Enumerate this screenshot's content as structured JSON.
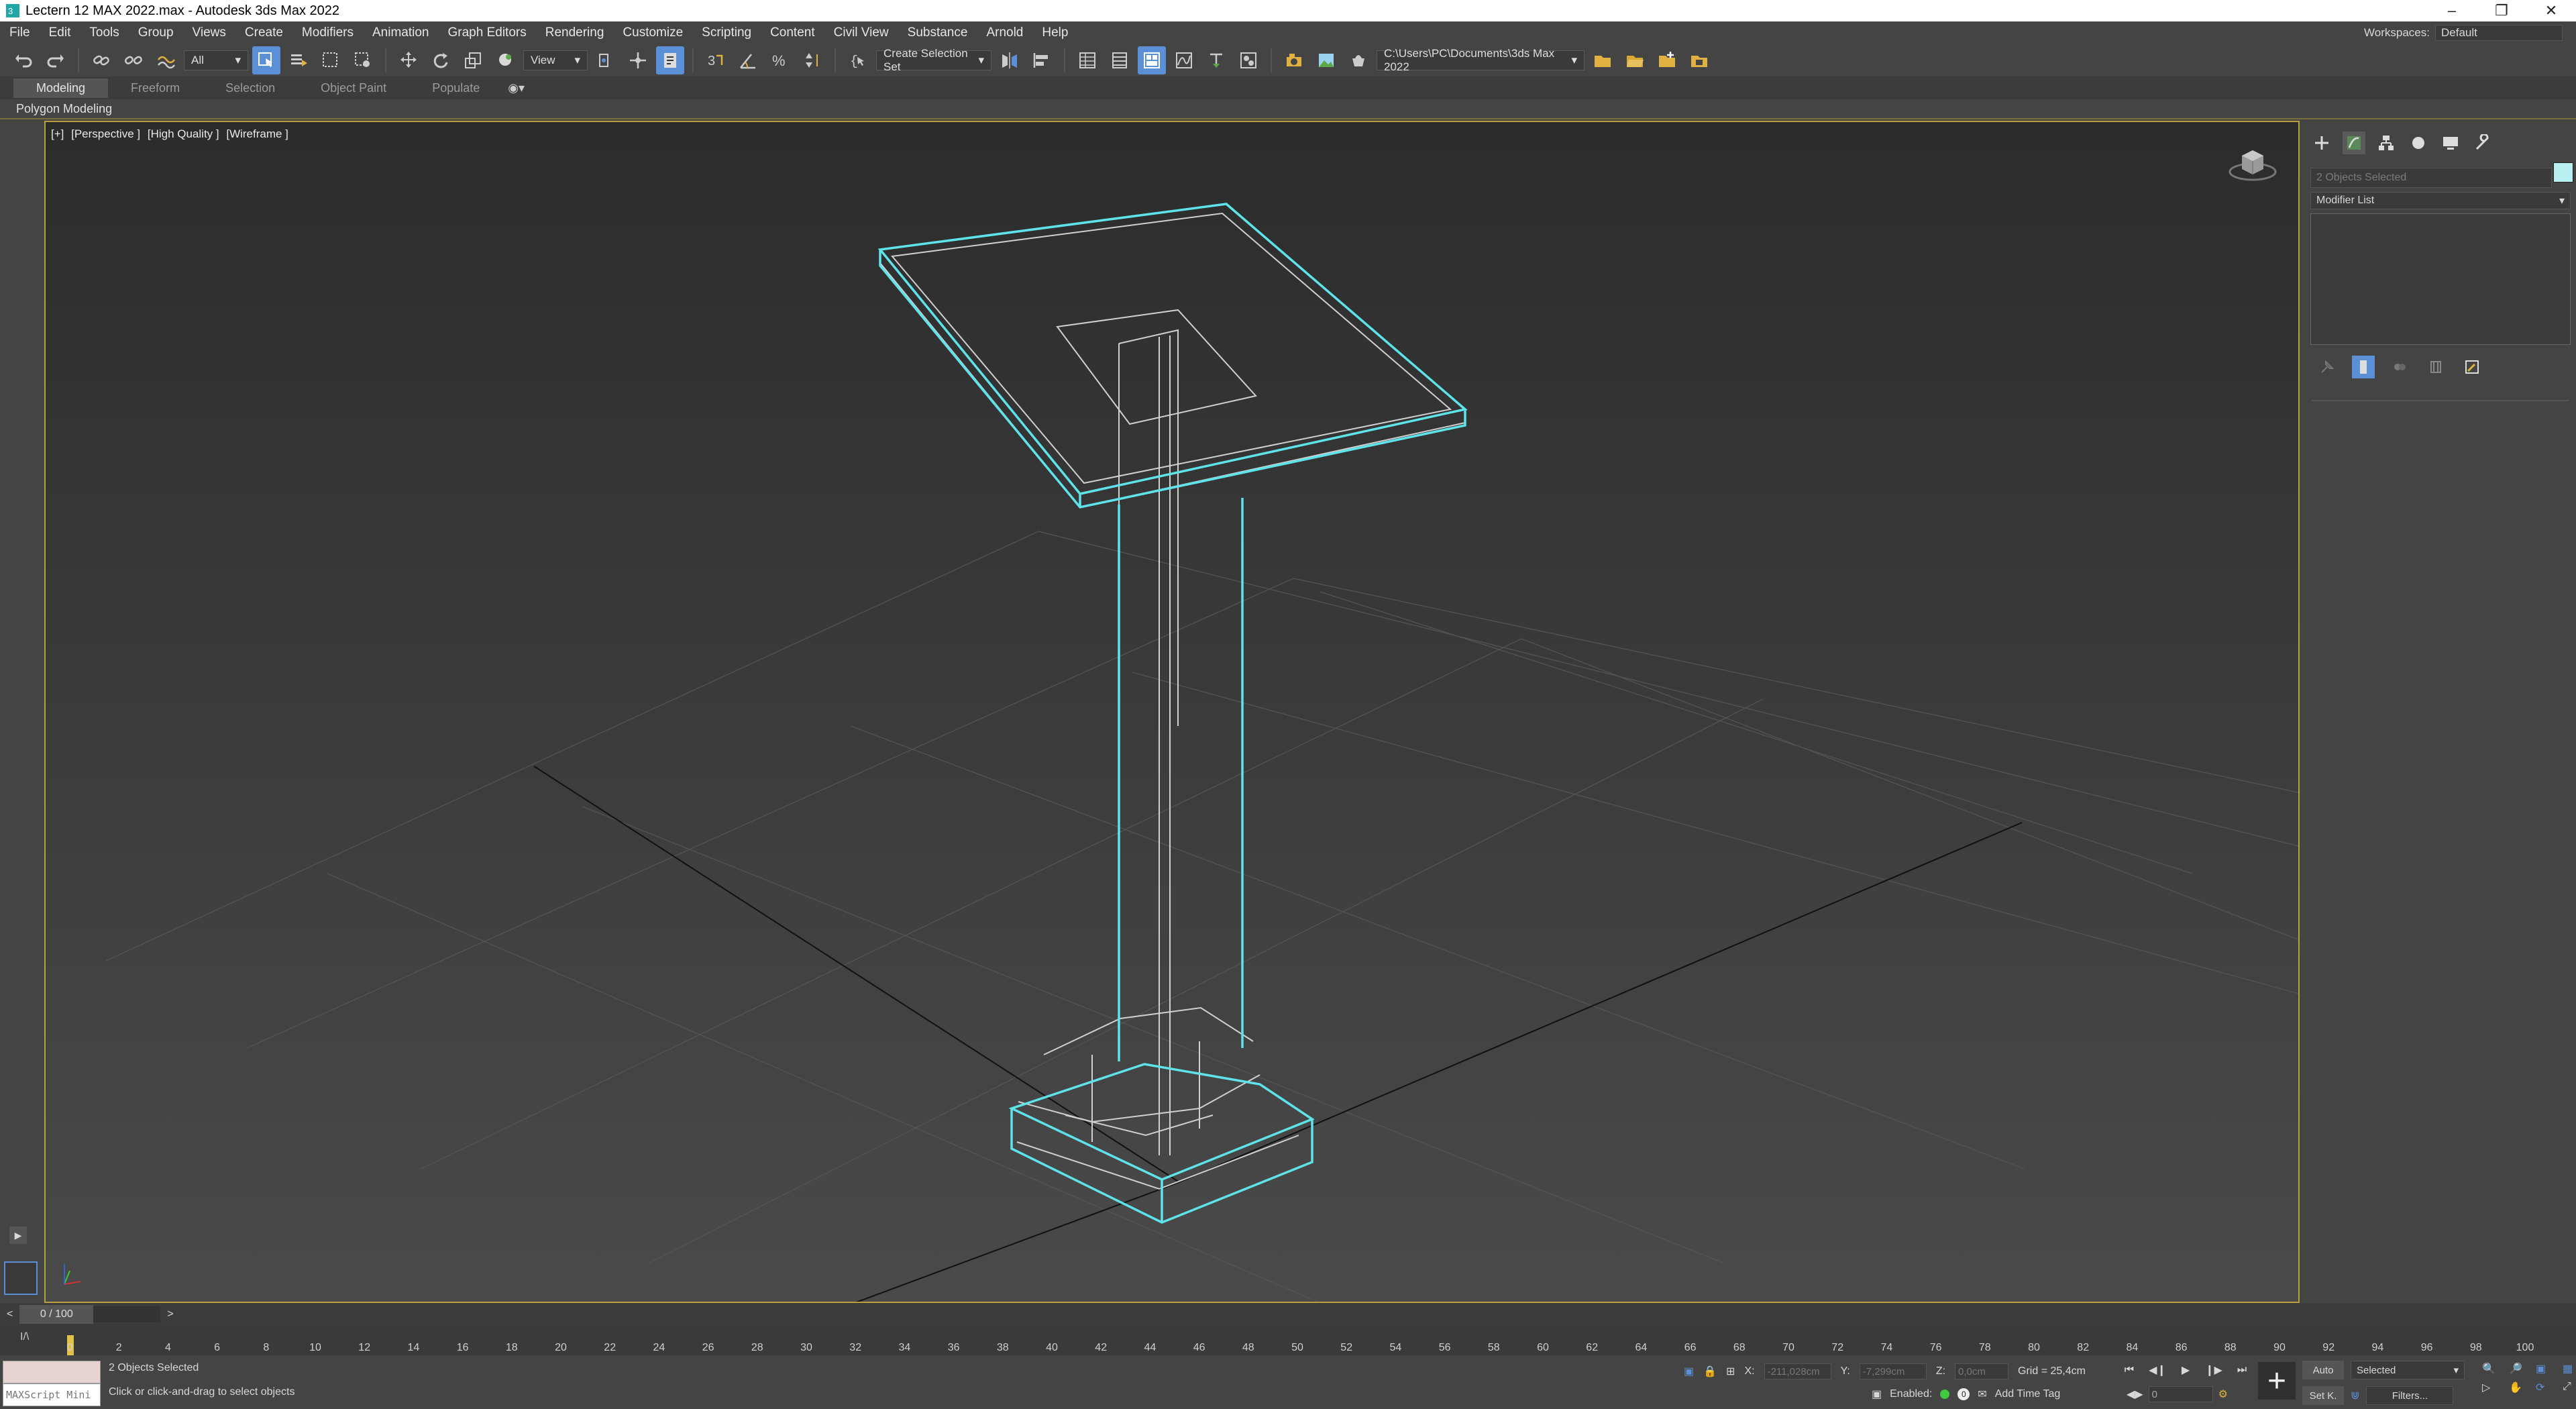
{
  "window": {
    "title": "Lectern 12 MAX 2022.max - Autodesk 3ds Max 2022",
    "app_icon": "3ds-max-icon",
    "controls": [
      "minimize-icon",
      "restore-icon",
      "close-icon"
    ]
  },
  "menu": {
    "items": [
      "File",
      "Edit",
      "Tools",
      "Group",
      "Views",
      "Create",
      "Modifiers",
      "Animation",
      "Graph Editors",
      "Rendering",
      "Customize",
      "Scripting",
      "Content",
      "Civil View",
      "Substance",
      "Arnold",
      "Help"
    ],
    "workspaces_label": "Workspaces:",
    "workspace_value": "Default"
  },
  "toolbar": {
    "selection_filter": "All",
    "reference_coord": "View",
    "named_selection": "Create Selection Set",
    "project_path": "C:\\Users\\PC\\Documents\\3ds Max 2022"
  },
  "ribbon": {
    "tabs": [
      "Modeling",
      "Freeform",
      "Selection",
      "Object Paint",
      "Populate"
    ],
    "active_tab": "Modeling",
    "sub_panel": "Polygon Modeling"
  },
  "viewport": {
    "labels": [
      "[+]",
      "[Perspective ]",
      "[High Quality ]",
      "[Wireframe ]"
    ],
    "wire_color": "#5fe3ea",
    "grid_color": "#555555"
  },
  "command_panel": {
    "tabs": [
      "create-icon",
      "modify-icon",
      "hierarchy-icon",
      "motion-icon",
      "display-icon",
      "utilities-icon"
    ],
    "object_name": "2 Objects Selected",
    "object_color": "#b8f0f2",
    "modifier_list": "Modifier List"
  },
  "time": {
    "slider": "0 / 100",
    "ticks": [
      0,
      2,
      4,
      6,
      8,
      10,
      12,
      14,
      16,
      18,
      20,
      22,
      24,
      26,
      28,
      30,
      32,
      34,
      36,
      38,
      40,
      42,
      44,
      46,
      48,
      50,
      52,
      54,
      56,
      58,
      60,
      62,
      64,
      66,
      68,
      70,
      72,
      74,
      76,
      78,
      80,
      82,
      84,
      86,
      88,
      90,
      92,
      94,
      96,
      98,
      100
    ]
  },
  "status": {
    "maxscript": "MAXScript Mini",
    "selection": "2 Objects Selected",
    "prompt": "Click or click-and-drag to select objects",
    "x_label": "X:",
    "x_value": "-211,028cm",
    "y_label": "Y:",
    "y_value": "-7,299cm",
    "z_label": "Z:",
    "z_value": "0,0cm",
    "grid": "Grid = 25,4cm",
    "enabled_label": "Enabled:",
    "add_time_tag": "Add Time Tag",
    "auto_key": "Auto",
    "set_key": "Set K.",
    "key_filter": "Selected",
    "filters": "Filters...",
    "frame": "0"
  }
}
